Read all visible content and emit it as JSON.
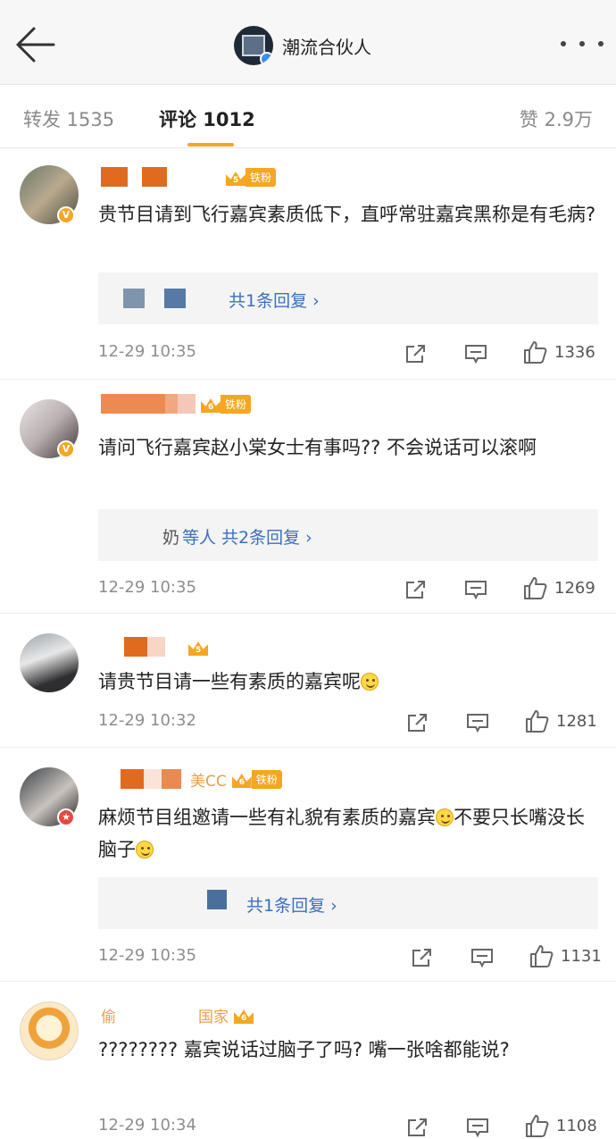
{
  "header": {
    "title": "潮流合伙人",
    "back_icon": "arrow-left-icon",
    "more_icon": "more-dots-icon"
  },
  "tabs": {
    "repost": "转发 1535",
    "comments": "评论 1012",
    "likes": "赞 2.9万"
  },
  "colors": {
    "accent": "#f5a623",
    "link": "#3c6fbf",
    "muted": "#8e8e8e"
  },
  "comments": [
    {
      "fan_label": "铁粉",
      "text": "贵节目请到飞行嘉宾素质低下，直呼常驻嘉宾黑称是有毛病?",
      "replies": "共1条回复 ›",
      "time": "12-29 10:35",
      "likes": "1336"
    },
    {
      "fan_label": "铁粉",
      "text": "请问飞行嘉宾赵小棠女士有事吗?? 不会说话可以滚啊",
      "replies": "等人  共2条回复 ›",
      "replies_prefix": "奶",
      "time": "12-29 10:35",
      "likes": "1269"
    },
    {
      "fan_label": "",
      "text": "请贵节目请一些有素质的嘉宾呢",
      "time": "12-29 10:32",
      "likes": "1281"
    },
    {
      "fan_label": "铁粉",
      "name_visible": "美CC",
      "text_part1": "麻烦节目组邀请一些有礼貌有素质的嘉宾",
      "text_part2": "不要只长嘴没长脑子",
      "replies": "共1条回复 ›",
      "time": "12-29 10:35",
      "likes": "1131"
    },
    {
      "fan_label": "",
      "name_visible_left": "偷",
      "name_visible_right": "国家",
      "text": "???????? 嘉宾说话过脑子了吗? 嘴一张啥都能说?",
      "time": "12-29 10:34",
      "likes": "1108"
    }
  ]
}
